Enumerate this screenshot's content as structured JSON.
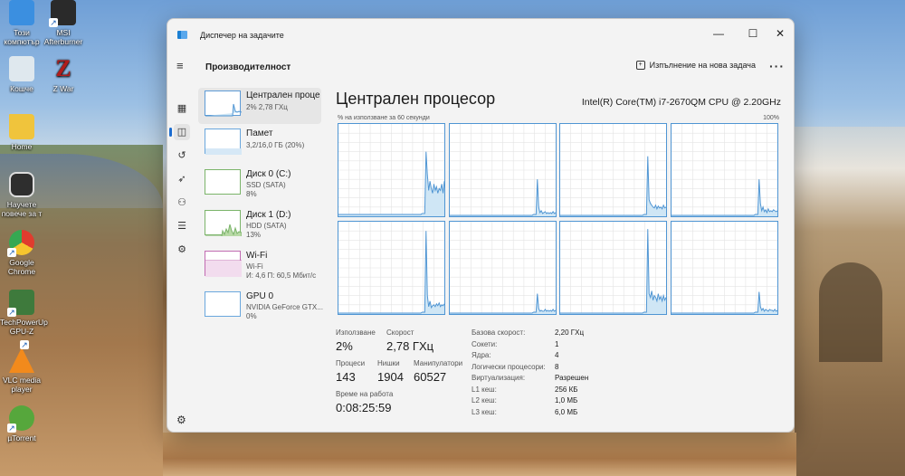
{
  "desktop": {
    "icons": [
      {
        "label": "Този компютър",
        "icon": "computer-icon",
        "color": "#3b8fe0"
      },
      {
        "label": "MSI Afterburner",
        "icon": "afterburner-icon",
        "color": "#2a2a2a"
      },
      {
        "label": "Кошче",
        "icon": "recycle-bin-icon",
        "color": "#dfe8ee"
      },
      {
        "label": "Z War",
        "icon": "z-war-icon",
        "color": "#b01c1c"
      },
      {
        "label": "Home",
        "icon": "folder-icon",
        "color": "#f0c43c"
      },
      {
        "label": "Научете повече за т",
        "icon": "learn-more-icon",
        "color": "#2e2e2e"
      },
      {
        "label": "Google Chrome",
        "icon": "chrome-icon",
        "color": "#e03c2e"
      },
      {
        "label": "TechPowerUp GPU-Z",
        "icon": "gpu-z-icon",
        "color": "#3e7a3c"
      },
      {
        "label": "VLC media player",
        "icon": "vlc-icon",
        "color": "#f28a1c"
      },
      {
        "label": "µTorrent",
        "icon": "utorrent-icon",
        "color": "#56a73c"
      }
    ]
  },
  "window": {
    "title": "Диспечер на задачите",
    "minimize": "—",
    "maximize": "☐",
    "close": "✕",
    "page_title": "Производителност",
    "new_task": "Изпълнение на нова задача",
    "more": "···",
    "settings_icon": "⚙"
  },
  "nav": [
    {
      "icon": "processes-icon",
      "glyph": "▦"
    },
    {
      "icon": "performance-icon",
      "glyph": "◫",
      "active": true
    },
    {
      "icon": "app-history-icon",
      "glyph": "↺"
    },
    {
      "icon": "startup-apps-icon",
      "glyph": "➶"
    },
    {
      "icon": "users-icon",
      "glyph": "⚇"
    },
    {
      "icon": "details-icon",
      "glyph": "☰"
    },
    {
      "icon": "services-icon",
      "glyph": "⚙"
    }
  ],
  "devices": [
    {
      "name": "Централен проце",
      "line1": "2% 2,78 ГХц",
      "line2": "",
      "active": true
    },
    {
      "name": "Памет",
      "line1": "3,2/16,0 ГБ (20%)",
      "line2": ""
    },
    {
      "name": "Диск 0 (C:)",
      "line1": "SSD (SATA)",
      "line2": "8%"
    },
    {
      "name": "Диск 1 (D:)",
      "line1": "HDD (SATA)",
      "line2": "13%"
    },
    {
      "name": "Wi-Fi",
      "line1": "Wi-Fi",
      "line2": "И: 4,6  П: 60,5 Мбит/с"
    },
    {
      "name": "GPU 0",
      "line1": "NVIDIA GeForce GTX...",
      "line2": "0%"
    }
  ],
  "cpu": {
    "title": "Централен процесор",
    "model": "Intel(R) Core(TM) i7-2670QM CPU @ 2.20GHz",
    "axis_left": "% на използване за 60 секунди",
    "axis_right": "100%",
    "core_usage": [
      [
        2,
        2,
        2,
        2,
        2,
        2,
        2,
        2,
        2,
        2,
        2,
        2,
        2,
        2,
        2,
        2,
        2,
        2,
        2,
        2,
        2,
        2,
        2,
        2,
        2,
        2,
        2,
        2,
        2,
        2,
        2,
        2,
        2,
        2,
        2,
        2,
        2,
        2,
        2,
        2,
        2,
        2,
        2,
        2,
        2,
        2,
        2,
        2,
        2,
        2,
        2,
        2,
        2,
        2,
        2,
        2,
        2,
        2,
        2,
        2,
        2,
        2,
        2,
        2,
        3,
        3,
        3,
        70,
        45,
        28,
        38,
        30,
        25,
        35,
        28,
        32,
        25,
        30,
        28,
        35,
        25,
        38
      ],
      [
        1,
        1,
        1,
        1,
        1,
        1,
        1,
        1,
        1,
        1,
        1,
        1,
        1,
        1,
        1,
        1,
        1,
        1,
        1,
        1,
        1,
        1,
        1,
        1,
        1,
        1,
        1,
        1,
        1,
        1,
        1,
        1,
        1,
        1,
        1,
        1,
        1,
        1,
        1,
        1,
        1,
        1,
        1,
        1,
        1,
        1,
        1,
        1,
        1,
        1,
        1,
        1,
        1,
        1,
        1,
        1,
        1,
        1,
        1,
        1,
        1,
        1,
        1,
        1,
        2,
        2,
        2,
        40,
        10,
        4,
        6,
        3,
        4,
        5,
        3,
        4,
        3,
        4,
        3,
        5,
        3,
        4
      ],
      [
        1,
        1,
        1,
        1,
        1,
        1,
        1,
        1,
        1,
        1,
        1,
        1,
        1,
        1,
        1,
        1,
        1,
        1,
        1,
        1,
        1,
        1,
        1,
        1,
        1,
        1,
        1,
        1,
        1,
        1,
        1,
        1,
        1,
        1,
        1,
        1,
        1,
        1,
        1,
        1,
        1,
        1,
        1,
        1,
        1,
        1,
        1,
        1,
        1,
        1,
        1,
        1,
        1,
        1,
        1,
        1,
        1,
        1,
        1,
        1,
        1,
        1,
        1,
        1,
        2,
        2,
        2,
        65,
        18,
        14,
        12,
        10,
        9,
        12,
        8,
        11,
        9,
        10,
        8,
        12,
        9,
        10
      ],
      [
        1,
        1,
        1,
        1,
        1,
        1,
        1,
        1,
        1,
        1,
        1,
        1,
        1,
        1,
        1,
        1,
        1,
        1,
        1,
        1,
        1,
        1,
        1,
        1,
        1,
        1,
        1,
        1,
        1,
        1,
        1,
        1,
        1,
        1,
        1,
        1,
        1,
        1,
        1,
        1,
        1,
        1,
        1,
        1,
        1,
        1,
        1,
        1,
        1,
        1,
        1,
        1,
        1,
        1,
        1,
        1,
        1,
        1,
        1,
        1,
        1,
        1,
        1,
        1,
        2,
        2,
        2,
        40,
        14,
        6,
        10,
        5,
        7,
        4,
        8,
        5,
        6,
        5,
        7,
        6,
        5,
        6
      ],
      [
        1,
        1,
        1,
        1,
        1,
        1,
        1,
        1,
        1,
        1,
        1,
        1,
        1,
        1,
        1,
        1,
        1,
        1,
        1,
        1,
        1,
        1,
        1,
        1,
        1,
        1,
        1,
        1,
        1,
        1,
        1,
        1,
        1,
        1,
        1,
        1,
        1,
        1,
        1,
        1,
        1,
        1,
        1,
        1,
        1,
        1,
        1,
        1,
        1,
        1,
        1,
        1,
        1,
        1,
        1,
        1,
        1,
        1,
        1,
        1,
        1,
        1,
        1,
        1,
        2,
        2,
        2,
        90,
        20,
        8,
        14,
        7,
        9,
        10,
        8,
        11,
        9,
        12,
        8,
        10,
        9,
        11
      ],
      [
        1,
        1,
        1,
        1,
        1,
        1,
        1,
        1,
        1,
        1,
        1,
        1,
        1,
        1,
        1,
        1,
        1,
        1,
        1,
        1,
        1,
        1,
        1,
        1,
        1,
        1,
        1,
        1,
        1,
        1,
        1,
        1,
        1,
        1,
        1,
        1,
        1,
        1,
        1,
        1,
        1,
        1,
        1,
        1,
        1,
        1,
        1,
        1,
        1,
        1,
        1,
        1,
        1,
        1,
        1,
        1,
        1,
        1,
        1,
        1,
        1,
        1,
        1,
        1,
        2,
        2,
        2,
        22,
        6,
        3,
        4,
        3,
        3,
        5,
        3,
        4,
        3,
        4,
        3,
        5,
        3,
        4
      ],
      [
        1,
        1,
        1,
        1,
        1,
        1,
        1,
        1,
        1,
        1,
        1,
        1,
        1,
        1,
        1,
        1,
        1,
        1,
        1,
        1,
        1,
        1,
        1,
        1,
        1,
        1,
        1,
        1,
        1,
        1,
        1,
        1,
        1,
        1,
        1,
        1,
        1,
        1,
        1,
        1,
        1,
        1,
        1,
        1,
        1,
        1,
        1,
        1,
        1,
        1,
        1,
        1,
        1,
        1,
        1,
        1,
        1,
        1,
        1,
        1,
        1,
        1,
        1,
        1,
        2,
        2,
        2,
        92,
        22,
        18,
        25,
        15,
        20,
        18,
        14,
        22,
        16,
        19,
        14,
        20,
        15,
        18
      ],
      [
        1,
        1,
        1,
        1,
        1,
        1,
        1,
        1,
        1,
        1,
        1,
        1,
        1,
        1,
        1,
        1,
        1,
        1,
        1,
        1,
        1,
        1,
        1,
        1,
        1,
        1,
        1,
        1,
        1,
        1,
        1,
        1,
        1,
        1,
        1,
        1,
        1,
        1,
        1,
        1,
        1,
        1,
        1,
        1,
        1,
        1,
        1,
        1,
        1,
        1,
        1,
        1,
        1,
        1,
        1,
        1,
        1,
        1,
        1,
        1,
        1,
        1,
        1,
        1,
        2,
        2,
        2,
        24,
        8,
        4,
        6,
        3,
        5,
        4,
        3,
        5,
        4,
        4,
        3,
        5,
        3,
        4
      ]
    ],
    "stats": {
      "usage_label": "Използване",
      "usage": "2%",
      "speed_label": "Скорост",
      "speed": "2,78 ГХц",
      "processes_label": "Процеси",
      "processes": "143",
      "threads_label": "Нишки",
      "threads": "1904",
      "handles_label": "Манипулатори",
      "handles": "60527",
      "uptime_label": "Време на работа",
      "uptime": "0:08:25:59"
    },
    "props": [
      {
        "label": "Базова скорост:",
        "value": "2,20 ГХц"
      },
      {
        "label": "Сокети:",
        "value": "1"
      },
      {
        "label": "Ядра:",
        "value": "4"
      },
      {
        "label": "Логически процесори:",
        "value": "8"
      },
      {
        "label": "Виртуализация:",
        "value": "Разрешен"
      },
      {
        "label": "L1 кеш:",
        "value": "256 КБ"
      },
      {
        "label": "L2 кеш:",
        "value": "1,0 МБ"
      },
      {
        "label": "L3 кеш:",
        "value": "6,0 МБ"
      }
    ]
  },
  "colors": {
    "accent": "#1b6cd0",
    "graph_line": "#4f95d3",
    "graph_fill": "#cfe6f5",
    "grid": "#e3e3e3"
  }
}
